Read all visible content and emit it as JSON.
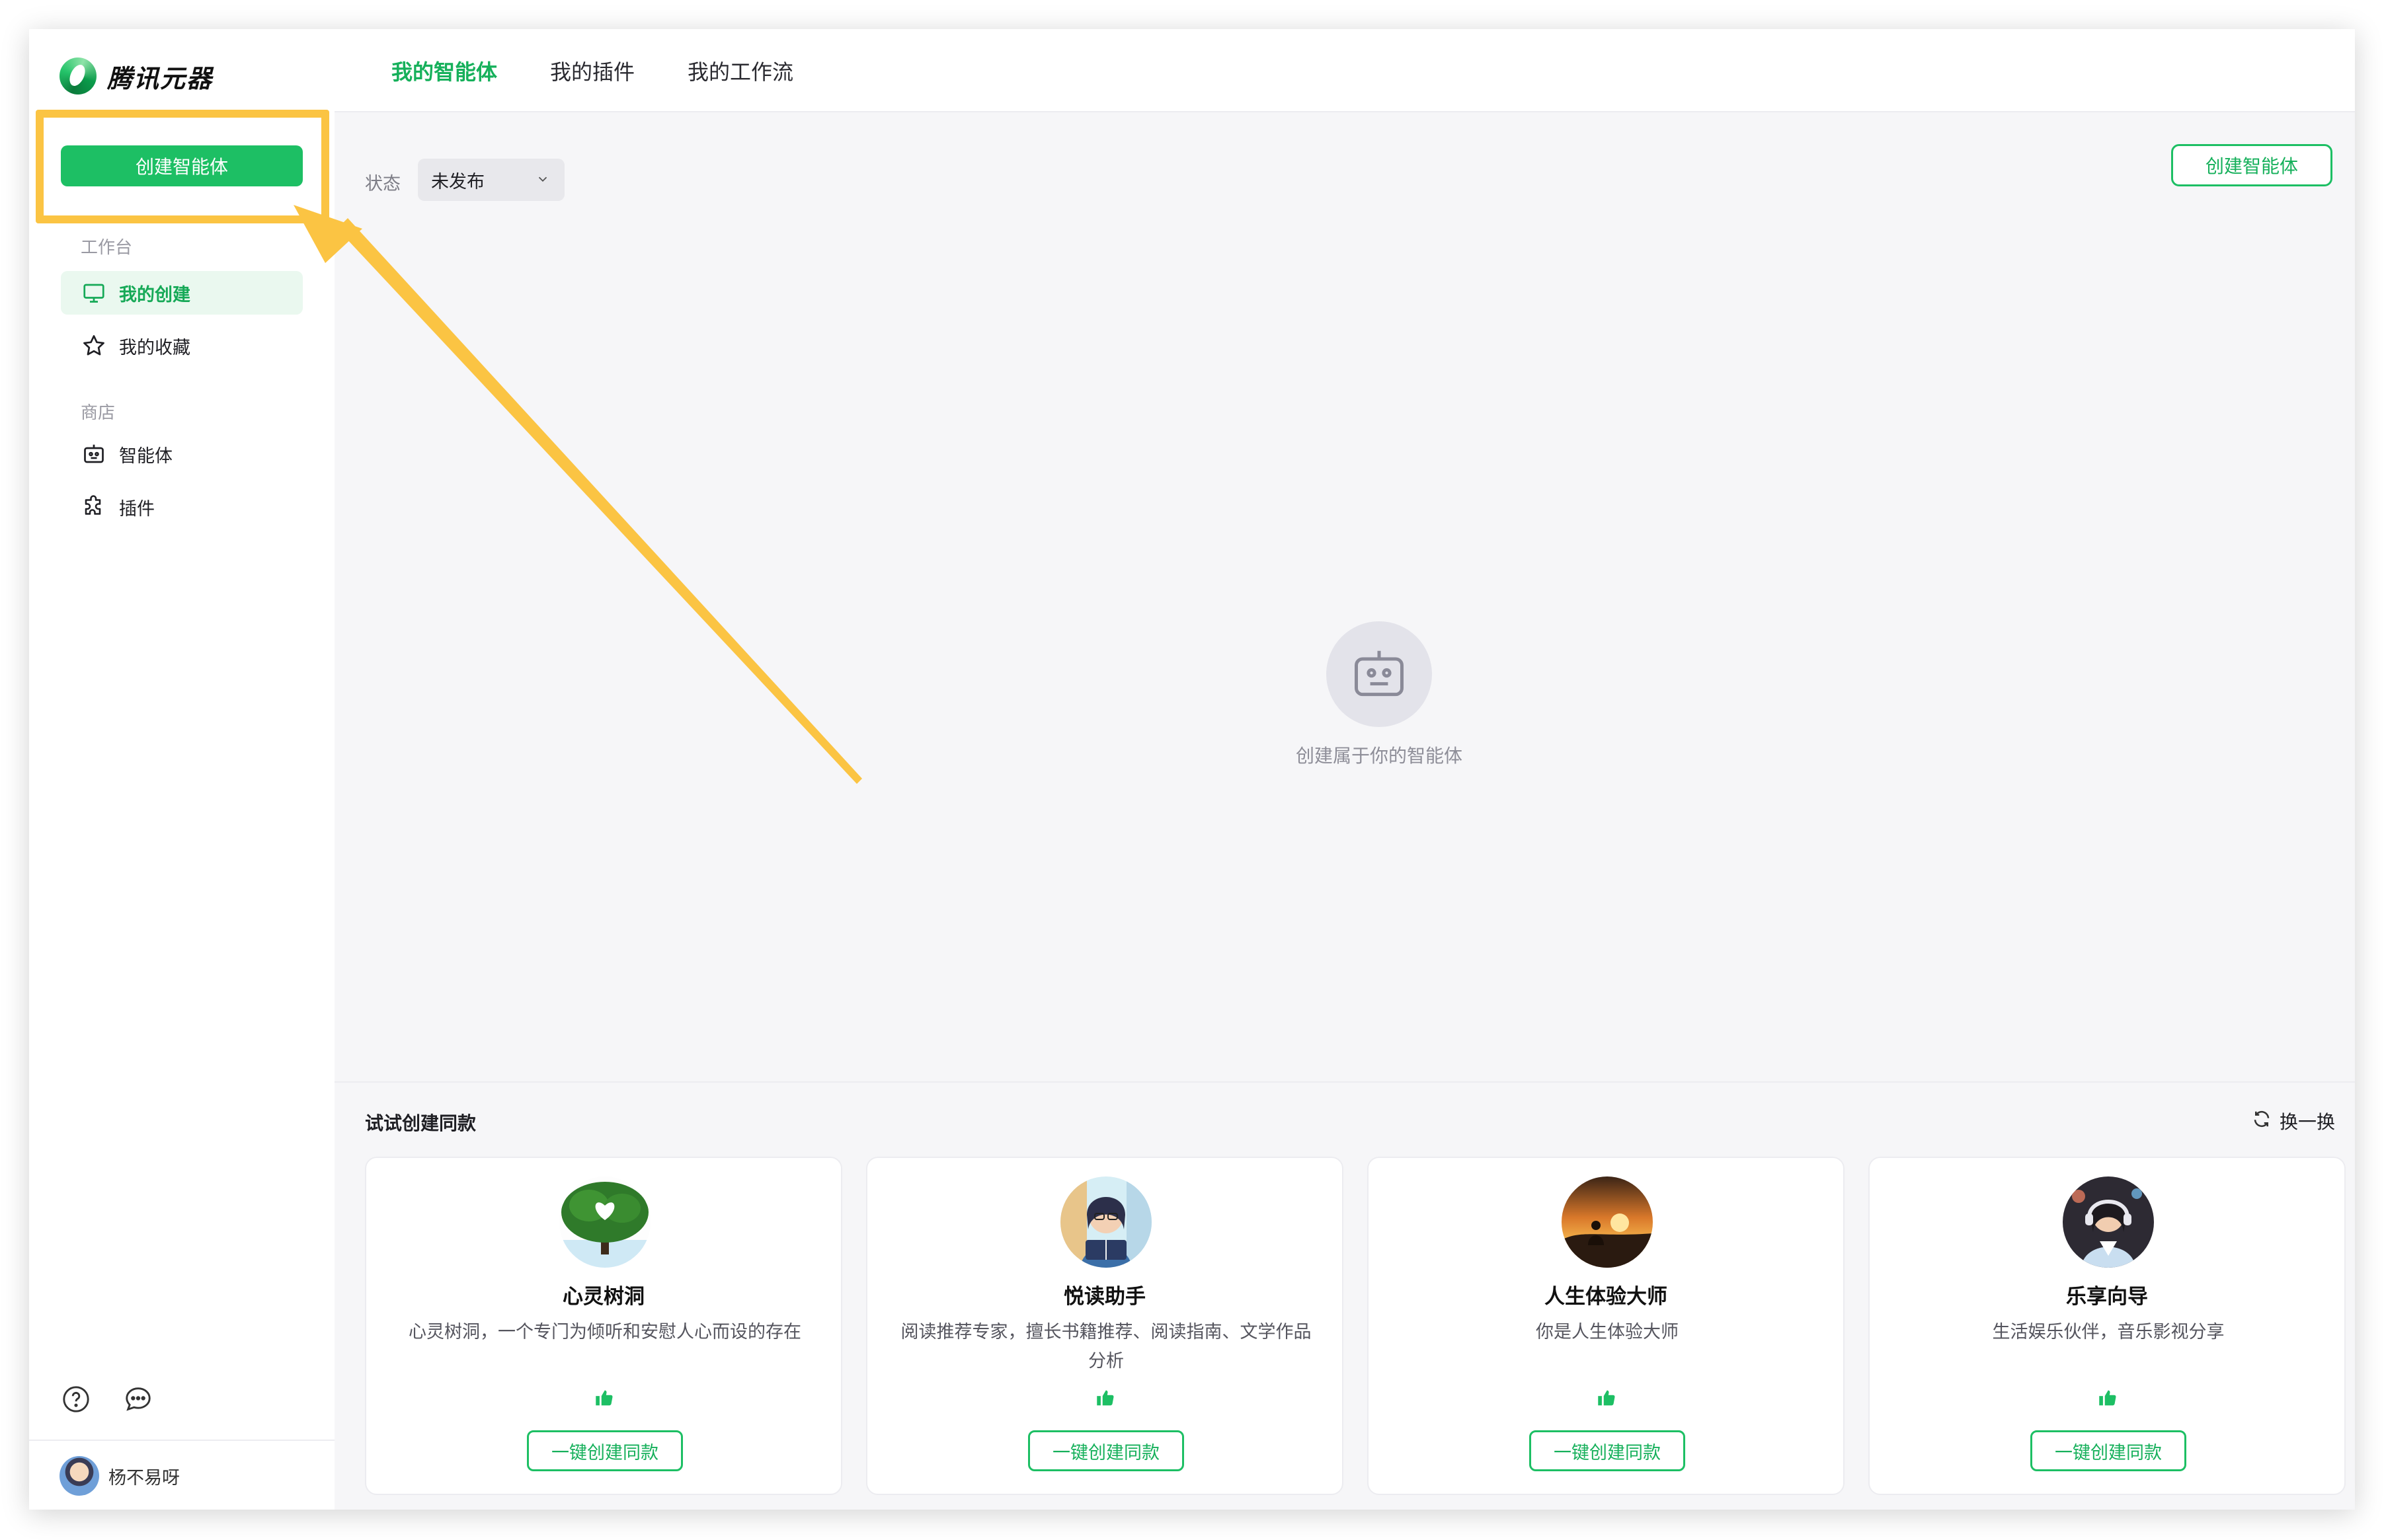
{
  "app": {
    "logo_text": "腾讯元器"
  },
  "sidebar": {
    "create_label": "创建智能体",
    "workspace_label": "工作台",
    "items_workspace": [
      {
        "label": "我的创建",
        "icon": "monitor-icon",
        "active": true
      },
      {
        "label": "我的收藏",
        "icon": "star-icon",
        "active": false
      }
    ],
    "store_label": "商店",
    "items_store": [
      {
        "label": "智能体",
        "icon": "robot-icon"
      },
      {
        "label": "插件",
        "icon": "puzzle-icon"
      }
    ],
    "bottom_icons": [
      "help-icon",
      "feedback-icon"
    ],
    "user_name": "杨不易呀"
  },
  "topbar": {
    "tabs": [
      {
        "label": "我的智能体",
        "active": true
      },
      {
        "label": "我的插件",
        "active": false
      },
      {
        "label": "我的工作流",
        "active": false
      }
    ]
  },
  "main": {
    "status_label": "状态",
    "status_value": "未发布",
    "create_label": "创建智能体",
    "empty_text": "创建属于你的智能体"
  },
  "try_section": {
    "title": "试试创建同款",
    "refresh_label": "换一换",
    "cards": [
      {
        "name": "心灵树洞",
        "desc": "心灵树洞，一个专门为倾听和安慰人心而设的存在",
        "button": "一键创建同款"
      },
      {
        "name": "悦读助手",
        "desc": "阅读推荐专家，擅长书籍推荐、阅读指南、文学作品分析",
        "button": "一键创建同款"
      },
      {
        "name": "人生体验大师",
        "desc": "你是人生体验大师",
        "button": "一键创建同款"
      },
      {
        "name": "乐享向导",
        "desc": "生活娱乐伙伴，音乐影视分享",
        "button": "一键创建同款"
      }
    ]
  },
  "colors": {
    "accent": "#1dbf64",
    "highlight": "#fbc443"
  }
}
